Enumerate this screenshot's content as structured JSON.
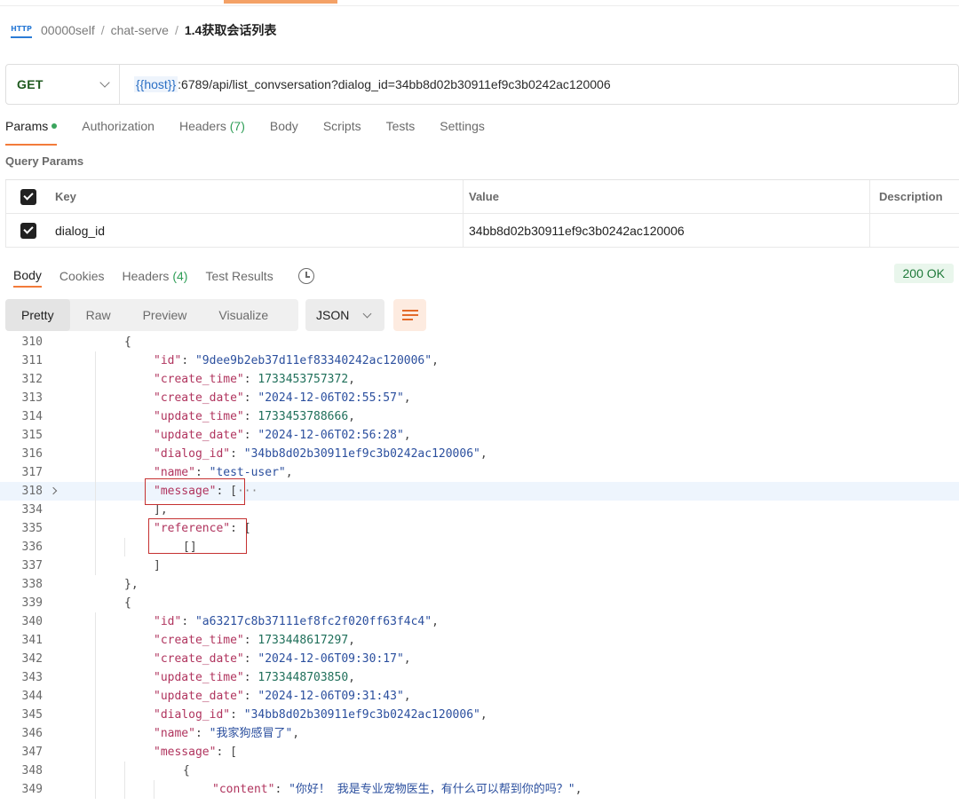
{
  "breadcrumb": {
    "icon_label": "HTTP",
    "items": [
      "00000self",
      "chat-serve"
    ],
    "current": "1.4获取会话列表"
  },
  "request": {
    "method": "GET",
    "url_var": "{{host}}",
    "url_rest": ":6789/api/list_convsersation?dialog_id=34bb8d02b30911ef9c3b0242ac120006"
  },
  "request_tabs": {
    "params": "Params",
    "authorization": "Authorization",
    "headers": "Headers",
    "headers_count": "(7)",
    "body": "Body",
    "scripts": "Scripts",
    "tests": "Tests",
    "settings": "Settings"
  },
  "query_params": {
    "title": "Query Params",
    "headers": {
      "key": "Key",
      "value": "Value",
      "description": "Description"
    },
    "rows": [
      {
        "key": "dialog_id",
        "value": "34bb8d02b30911ef9c3b0242ac120006",
        "description": ""
      }
    ]
  },
  "response_tabs": {
    "body": "Body",
    "cookies": "Cookies",
    "headers": "Headers",
    "headers_count": "(4)",
    "test_results": "Test Results"
  },
  "status": "200 OK",
  "view_modes": {
    "pretty": "Pretty",
    "raw": "Raw",
    "preview": "Preview",
    "visualize": "Visualize"
  },
  "format": "JSON",
  "code_lines": [
    {
      "n": "310",
      "indent": 1,
      "html": "<span class=\"p\">{</span>"
    },
    {
      "n": "311",
      "indent": 2,
      "html": "<span class=\"k\">\"id\"</span><span class=\"p\">: </span><span class=\"s\">\"9dee9b2eb37d11ef83340242ac120006\"</span><span class=\"p\">,</span>"
    },
    {
      "n": "312",
      "indent": 2,
      "html": "<span class=\"k\">\"create_time\"</span><span class=\"p\">: </span><span class=\"n\">1733453757372</span><span class=\"p\">,</span>"
    },
    {
      "n": "313",
      "indent": 2,
      "html": "<span class=\"k\">\"create_date\"</span><span class=\"p\">: </span><span class=\"s\">\"2024-12-06T02:55:57\"</span><span class=\"p\">,</span>"
    },
    {
      "n": "314",
      "indent": 2,
      "html": "<span class=\"k\">\"update_time\"</span><span class=\"p\">: </span><span class=\"n\">1733453788666</span><span class=\"p\">,</span>"
    },
    {
      "n": "315",
      "indent": 2,
      "html": "<span class=\"k\">\"update_date\"</span><span class=\"p\">: </span><span class=\"s\">\"2024-12-06T02:56:28\"</span><span class=\"p\">,</span>"
    },
    {
      "n": "316",
      "indent": 2,
      "html": "<span class=\"k\">\"dialog_id\"</span><span class=\"p\">: </span><span class=\"s\">\"34bb8d02b30911ef9c3b0242ac120006\"</span><span class=\"p\">,</span>"
    },
    {
      "n": "317",
      "indent": 2,
      "html": "<span class=\"k\">\"name\"</span><span class=\"p\">: </span><span class=\"s\">\"test-user\"</span><span class=\"p\">,</span>"
    },
    {
      "n": "318",
      "indent": 2,
      "fold": true,
      "hl": true,
      "html": "<span class=\"k\">\"message\"</span><span class=\"p\">: [</span><span class=\"ell\">···</span>"
    },
    {
      "n": "334",
      "indent": 2,
      "html": "<span class=\"p\">],</span>"
    },
    {
      "n": "335",
      "indent": 2,
      "html": "<span class=\"k\">\"reference\"</span><span class=\"p\">: [</span>"
    },
    {
      "n": "336",
      "indent": 3,
      "html": "<span class=\"p\">[]</span>"
    },
    {
      "n": "337",
      "indent": 2,
      "html": "<span class=\"p\">]</span>"
    },
    {
      "n": "338",
      "indent": 1,
      "html": "<span class=\"p\">},</span>"
    },
    {
      "n": "339",
      "indent": 1,
      "html": "<span class=\"p\">{</span>"
    },
    {
      "n": "340",
      "indent": 2,
      "html": "<span class=\"k\">\"id\"</span><span class=\"p\">: </span><span class=\"s\">\"a63217c8b37111ef8fc2f020ff63f4c4\"</span><span class=\"p\">,</span>"
    },
    {
      "n": "341",
      "indent": 2,
      "html": "<span class=\"k\">\"create_time\"</span><span class=\"p\">: </span><span class=\"n\">1733448617297</span><span class=\"p\">,</span>"
    },
    {
      "n": "342",
      "indent": 2,
      "html": "<span class=\"k\">\"create_date\"</span><span class=\"p\">: </span><span class=\"s\">\"2024-12-06T09:30:17\"</span><span class=\"p\">,</span>"
    },
    {
      "n": "343",
      "indent": 2,
      "html": "<span class=\"k\">\"update_time\"</span><span class=\"p\">: </span><span class=\"n\">1733448703850</span><span class=\"p\">,</span>"
    },
    {
      "n": "344",
      "indent": 2,
      "html": "<span class=\"k\">\"update_date\"</span><span class=\"p\">: </span><span class=\"s\">\"2024-12-06T09:31:43\"</span><span class=\"p\">,</span>"
    },
    {
      "n": "345",
      "indent": 2,
      "html": "<span class=\"k\">\"dialog_id\"</span><span class=\"p\">: </span><span class=\"s\">\"34bb8d02b30911ef9c3b0242ac120006\"</span><span class=\"p\">,</span>"
    },
    {
      "n": "346",
      "indent": 2,
      "html": "<span class=\"k\">\"name\"</span><span class=\"p\">: </span><span class=\"s\">\"我家狗感冒了\"</span><span class=\"p\">,</span>"
    },
    {
      "n": "347",
      "indent": 2,
      "html": "<span class=\"k\">\"message\"</span><span class=\"p\">: [</span>"
    },
    {
      "n": "348",
      "indent": 3,
      "html": "<span class=\"p\">{</span>"
    },
    {
      "n": "349",
      "indent": 4,
      "html": "<span class=\"k\">\"content\"</span><span class=\"p\">: </span><span class=\"s\">\"你好！ 我是专业宠物医生，有什么可以帮到你的吗？\"</span><span class=\"p\">,</span>"
    }
  ]
}
